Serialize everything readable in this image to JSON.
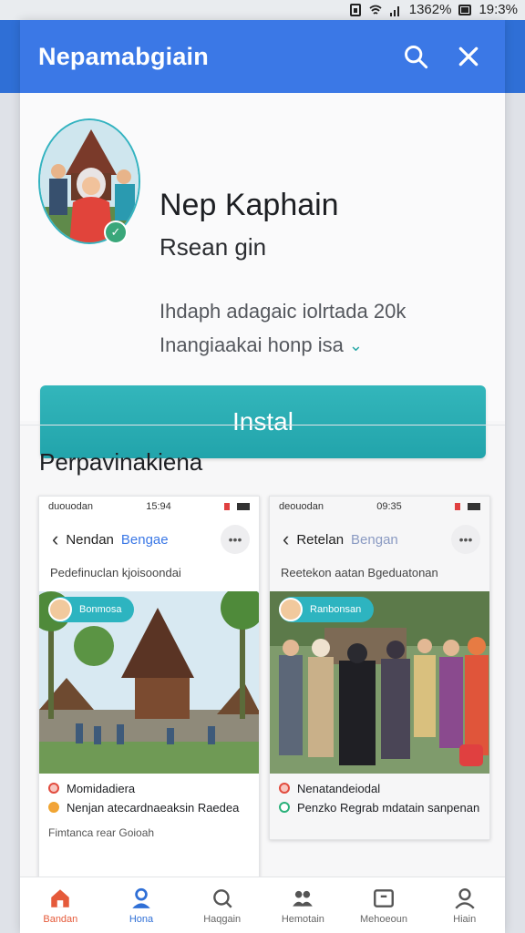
{
  "status_bar": {
    "battery": "1362%",
    "time": "19:3%"
  },
  "appbar": {
    "title": "Nepamabgiain"
  },
  "app": {
    "name": "Nep Kaphain",
    "developer": "Rsean gin",
    "meta_line_1": "Ihdaph adagaic iolrtada 20k",
    "meta_line_2": "Inangiaakai honp isa",
    "install_label": "Instal"
  },
  "section": {
    "title": "Perpavinakiena"
  },
  "screenshots": [
    {
      "status_left": "duouodan",
      "status_time": "15:94",
      "nav_title": "Nendan",
      "nav_link": "Bengae",
      "subtitle": "Pedefinuclan kjoisoondai",
      "chip_label": "Bonmosa",
      "items": [
        "Momidadiera",
        "Nenjan atecardnaeaksin Raedea"
      ],
      "footer": "Fimtanca rear Goioah"
    },
    {
      "status_left": "deouodan",
      "status_time": "09:35",
      "nav_title": "Retelan",
      "nav_link": "Bengan",
      "subtitle": "Reetekon aatan Bgeduatonan",
      "chip_label": "Ranbonsan",
      "items": [
        "Nenatandeiodal",
        "Penzko Regrab mdatain sanpenan"
      ]
    }
  ],
  "bottom_nav": [
    {
      "label": "Bandan",
      "icon": "home-icon"
    },
    {
      "label": "Hona",
      "icon": "person-icon"
    },
    {
      "label": "Haqgain",
      "icon": "search-icon"
    },
    {
      "label": "Hemotain",
      "icon": "group-icon"
    },
    {
      "label": "Mehoeoun",
      "icon": "inbox-icon"
    },
    {
      "label": "Hiain",
      "icon": "profile-icon"
    }
  ],
  "colors": {
    "appbar": "#3b78e6",
    "install": "#22a4ab",
    "accent_red": "#e55a3a",
    "accent_blue": "#2f6fd6"
  }
}
